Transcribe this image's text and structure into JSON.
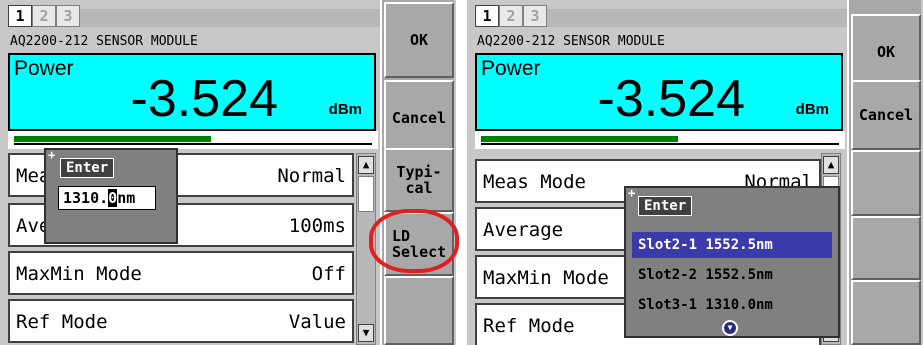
{
  "left": {
    "tabs": [
      "1",
      "2",
      "3"
    ],
    "module_title": "AQ2200-212 SENSOR MODULE",
    "power": {
      "label": "Power",
      "value": "-3.524",
      "unit": "dBm"
    },
    "level_bar_fraction": 0.55,
    "rows": [
      {
        "label": "Meas Mode",
        "value": "Normal"
      },
      {
        "label": "Average",
        "value": "100ms"
      },
      {
        "label": "MaxMin Mode",
        "value": "Off"
      },
      {
        "label": "Ref Mode",
        "value": "Value"
      }
    ],
    "softkeys": [
      "OK",
      "Cancel",
      "Typi-\ncal",
      "LD\nSelect",
      ""
    ],
    "dialog": {
      "plus": "+",
      "title": "Enter",
      "value_before": "1310.",
      "value_cursor": "0",
      "value_after": "nm"
    }
  },
  "right": {
    "tabs": [
      "1",
      "2",
      "3"
    ],
    "module_title": "AQ2200-212 SENSOR MODULE",
    "power": {
      "label": "Power",
      "value": "-3.524",
      "unit": "dBm"
    },
    "level_bar_fraction": 0.55,
    "rows": [
      {
        "label": "Meas Mode",
        "value": "Normal"
      },
      {
        "label": "Average",
        "value": ""
      },
      {
        "label": "MaxMin Mode",
        "value": ""
      },
      {
        "label": "Ref Mode",
        "value": ""
      }
    ],
    "softkeys": [
      "OK",
      "Cancel",
      "",
      "",
      ""
    ],
    "dialog": {
      "plus": "+",
      "title": "Enter",
      "options": [
        "Slot2-1 1552.5nm",
        "Slot2-2 1552.5nm",
        "Slot3-1 1310.0nm"
      ],
      "selected_index": 0
    }
  },
  "colors": {
    "power_bg": "#00ffff",
    "bar": "#008000",
    "selected": "#3a3aaa",
    "highlight": "#e02020"
  },
  "icons": {
    "scroll_up": "up-arrow-icon",
    "scroll_down": "down-arrow-icon",
    "more": "chevron-down-circle-icon"
  }
}
